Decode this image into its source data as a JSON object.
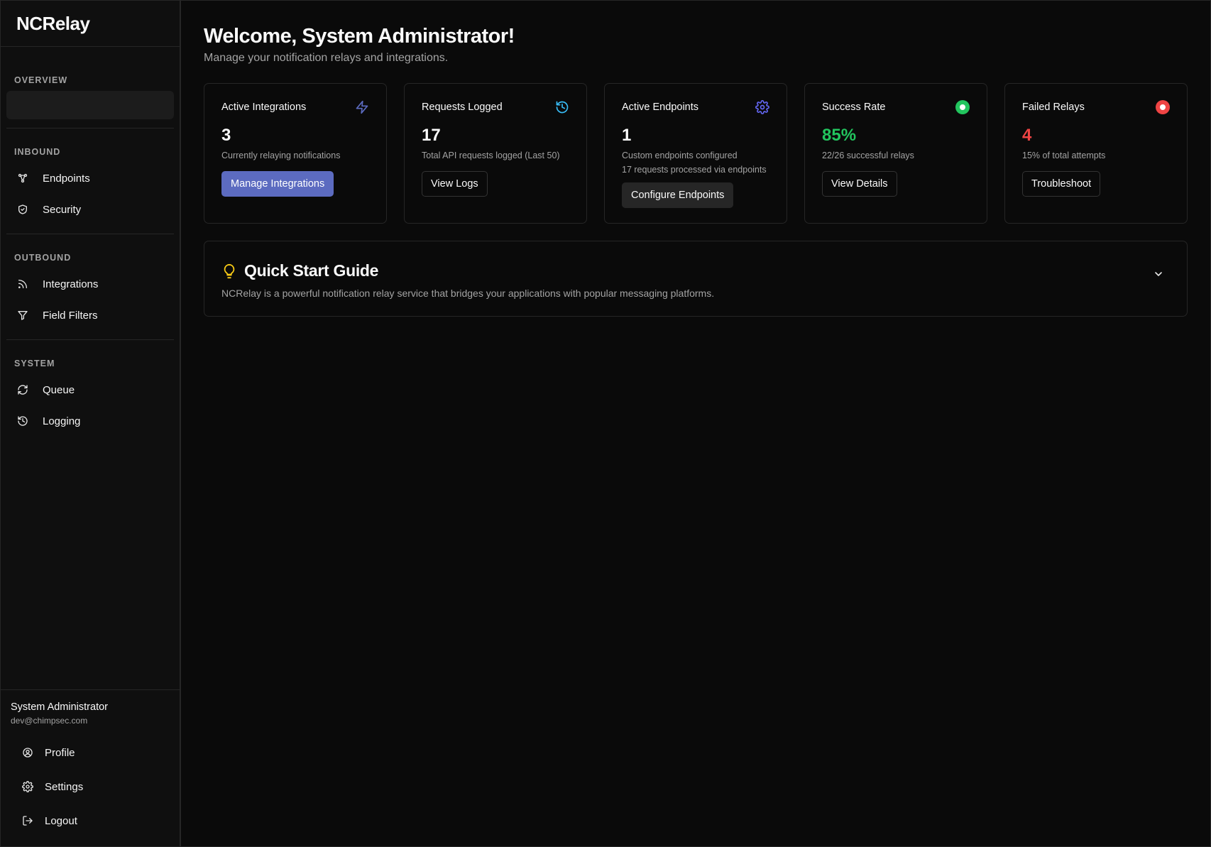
{
  "brand": "NCRelay",
  "sidebar": {
    "overview_label": "OVERVIEW",
    "inbound_label": "INBOUND",
    "inbound_items": [
      {
        "label": "Endpoints",
        "icon": "endpoints-icon"
      },
      {
        "label": "Security",
        "icon": "shield-icon"
      }
    ],
    "outbound_label": "OUTBOUND",
    "outbound_items": [
      {
        "label": "Integrations",
        "icon": "rss-icon"
      },
      {
        "label": "Field Filters",
        "icon": "filter-icon"
      }
    ],
    "system_label": "SYSTEM",
    "system_items": [
      {
        "label": "Queue",
        "icon": "refresh-icon"
      },
      {
        "label": "Logging",
        "icon": "history-icon"
      }
    ]
  },
  "user": {
    "name": "System Administrator",
    "email": "dev@chimpsec.com",
    "menu": [
      {
        "label": "Profile",
        "icon": "user-circle-icon"
      },
      {
        "label": "Settings",
        "icon": "gear-icon"
      },
      {
        "label": "Logout",
        "icon": "logout-icon"
      }
    ]
  },
  "main": {
    "title": "Welcome, System Administrator!",
    "subtitle": "Manage your notification relays and integrations."
  },
  "cards": [
    {
      "title": "Active Integrations",
      "value": "3",
      "desc": "Currently relaying notifications",
      "button": "Manage Integrations",
      "icon": "lightning-icon",
      "icon_color": "#5c6bc0"
    },
    {
      "title": "Requests Logged",
      "value": "17",
      "desc": "Total API requests logged (Last 50)",
      "button": "View Logs",
      "icon": "history-icon",
      "icon_color": "#38bdf8"
    },
    {
      "title": "Active Endpoints",
      "value": "1",
      "desc": "Custom endpoints configured",
      "desc2": "17 requests processed via endpoints",
      "button": "Configure Endpoints",
      "icon": "gear-icon",
      "icon_color": "#6366f1"
    },
    {
      "title": "Success Rate",
      "value": "85%",
      "desc": "22/26 successful relays",
      "button": "View Details",
      "icon": "status-dot-icon",
      "icon_color": "#22c55e"
    },
    {
      "title": "Failed Relays",
      "value": "4",
      "desc": "15% of total attempts",
      "button": "Troubleshoot",
      "icon": "status-dot-icon",
      "icon_color": "#ef4444"
    }
  ],
  "guide": {
    "title": "Quick Start Guide",
    "desc": "NCRelay is a powerful notification relay service that bridges your applications with popular messaging platforms.",
    "icon": "lightbulb-icon",
    "icon_color": "#facc15"
  }
}
